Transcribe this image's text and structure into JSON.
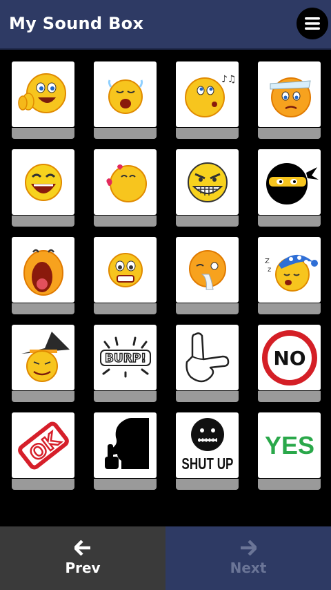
{
  "header": {
    "title": "My Sound Box",
    "menu_icon": "hamburger-menu-icon"
  },
  "sounds": [
    {
      "icon": "clapping-emoji-icon"
    },
    {
      "icon": "crying-emoji-icon"
    },
    {
      "icon": "whistling-emoji-icon"
    },
    {
      "icon": "sick-emoji-icon"
    },
    {
      "icon": "laughing-emoji-icon"
    },
    {
      "icon": "kissing-emoji-icon"
    },
    {
      "icon": "evil-grin-emoji-icon"
    },
    {
      "icon": "ninja-emoji-icon"
    },
    {
      "icon": "screaming-emoji-icon"
    },
    {
      "icon": "scared-emoji-icon"
    },
    {
      "icon": "coughing-emoji-icon"
    },
    {
      "icon": "sleeping-emoji-icon"
    },
    {
      "icon": "witch-emoji-icon"
    },
    {
      "icon": "burp-icon",
      "text": "BURP!"
    },
    {
      "icon": "loser-hand-icon"
    },
    {
      "icon": "no-sign-icon",
      "text": "NO"
    },
    {
      "icon": "ok-stamp-icon",
      "text": "OK"
    },
    {
      "icon": "shush-silhouette-icon"
    },
    {
      "icon": "shut-up-icon",
      "text": "SHUT UP"
    },
    {
      "icon": "yes-text-icon",
      "text": "YES"
    }
  ],
  "footer": {
    "prev": {
      "label": "Prev",
      "icon": "arrow-left-icon",
      "color": "#ffffff"
    },
    "next": {
      "label": "Next",
      "icon": "arrow-right-icon",
      "color": "#6b7597"
    }
  }
}
